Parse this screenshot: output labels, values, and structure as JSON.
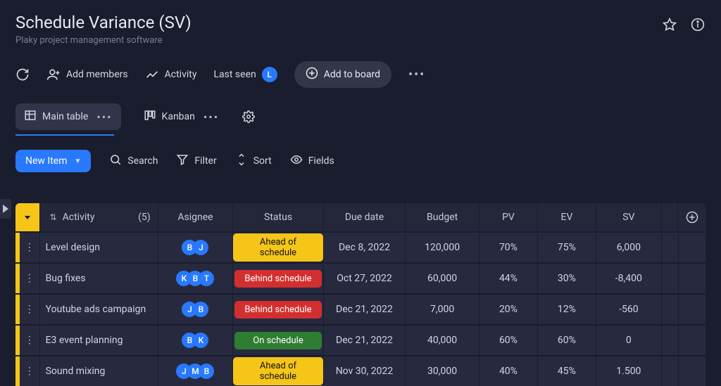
{
  "header": {
    "title": "Schedule Variance (SV)",
    "subtitle": "Plaky project management software"
  },
  "toolbar": {
    "addMembers": "Add members",
    "activity": "Activity",
    "lastSeen": "Last seen",
    "lastSeenInitial": "L",
    "addToBoard": "Add to board"
  },
  "views": {
    "main": "Main table",
    "kanban": "Kanban"
  },
  "actions": {
    "newItem": "New Item",
    "search": "Search",
    "filter": "Filter",
    "sort": "Sort",
    "fields": "Fields"
  },
  "columns": {
    "activity": "Activity",
    "count": "(5)",
    "assignee": "Asignee",
    "status": "Status",
    "due": "Due date",
    "budget": "Budget",
    "pv": "PV",
    "ev": "EV",
    "sv": "SV"
  },
  "rows": [
    {
      "activity": "Level design",
      "assignees": [
        "B",
        "J"
      ],
      "status": "Ahead of schedule",
      "statusClass": "stat-ahead",
      "due": "Dec 8, 2022",
      "budget": "120,000",
      "pv": "70%",
      "ev": "75%",
      "sv": "6,000"
    },
    {
      "activity": "Bug fixes",
      "assignees": [
        "K",
        "B",
        "T"
      ],
      "status": "Behind schedule",
      "statusClass": "stat-behind",
      "due": "Oct 27, 2022",
      "budget": "60,000",
      "pv": "44%",
      "ev": "30%",
      "sv": "-8,400"
    },
    {
      "activity": "Youtube ads campaign",
      "assignees": [
        "J",
        "B"
      ],
      "status": "Behind schedule",
      "statusClass": "stat-behind",
      "due": "Dec 21, 2022",
      "budget": "7,000",
      "pv": "20%",
      "ev": "12%",
      "sv": "-560"
    },
    {
      "activity": "E3 event planning",
      "assignees": [
        "B",
        "K"
      ],
      "status": "On schedule",
      "statusClass": "stat-on",
      "due": "Dec 21, 2022",
      "budget": "40,000",
      "pv": "60%",
      "ev": "60%",
      "sv": "0"
    },
    {
      "activity": "Sound mixing",
      "assignees": [
        "J",
        "M",
        "B"
      ],
      "status": "Ahead of schedule",
      "statusClass": "stat-ahead",
      "due": "Nov 30, 2022",
      "budget": "30,000",
      "pv": "40%",
      "ev": "45%",
      "sv": "1.500"
    }
  ]
}
